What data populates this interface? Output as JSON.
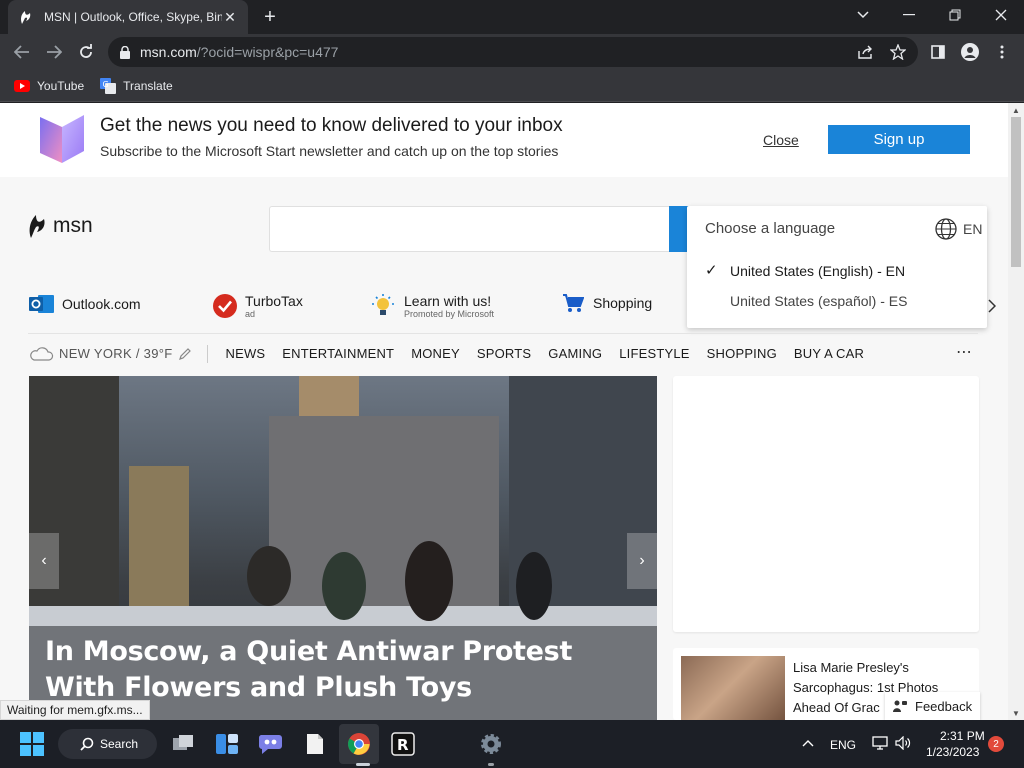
{
  "browser": {
    "tab_title": "MSN | Outlook, Office, Skype, Bin",
    "url_host": "msn.com",
    "url_rest": "/?ocid=wispr&pc=u477",
    "bookmarks": [
      {
        "label": "YouTube",
        "icon": "youtube-icon"
      },
      {
        "label": "Translate",
        "icon": "translate-icon"
      }
    ],
    "status_text": "Waiting for mem.gfx.ms..."
  },
  "banner": {
    "title": "Get the news you need to know delivered to your inbox",
    "subtitle": "Subscribe to the Microsoft Start newsletter and catch up on the top stories",
    "close_label": "Close",
    "signup_label": "Sign up"
  },
  "header": {
    "logo_text": "msn"
  },
  "language": {
    "header": "Choose a language",
    "current": "EN",
    "options": [
      {
        "label": "United States (English) - EN",
        "selected": true
      },
      {
        "label": "United States (español) - ES",
        "selected": false
      }
    ]
  },
  "quick_links": [
    {
      "label": "Outlook.com",
      "sub": ""
    },
    {
      "label": "TurboTax",
      "sub": "ad"
    },
    {
      "label": "Learn with us!",
      "sub": "Promoted by Microsoft"
    },
    {
      "label": "Shopping",
      "sub": ""
    }
  ],
  "nav": {
    "weather": "NEW YORK / 39°F",
    "links": [
      "NEWS",
      "ENTERTAINMENT",
      "MONEY",
      "SPORTS",
      "GAMING",
      "LIFESTYLE",
      "SHOPPING",
      "BUY A CAR"
    ],
    "more": "⋯"
  },
  "hero": {
    "headline": "In Moscow, a Quiet Antiwar Protest With Flowers and Plush Toys"
  },
  "story": {
    "title": "Lisa Marie Presley's Sarcophagus: 1st Photos Ahead Of Grac"
  },
  "feedback_label": "Feedback",
  "taskbar": {
    "search_label": "Search",
    "lang": "ENG",
    "time": "2:31 PM",
    "date": "1/23/2023",
    "notifications": "2"
  },
  "colors": {
    "accent": "#1a84d8",
    "chrome_dark": "#202124",
    "chrome_mid": "#35363a",
    "taskbar": "#1c1f26"
  }
}
